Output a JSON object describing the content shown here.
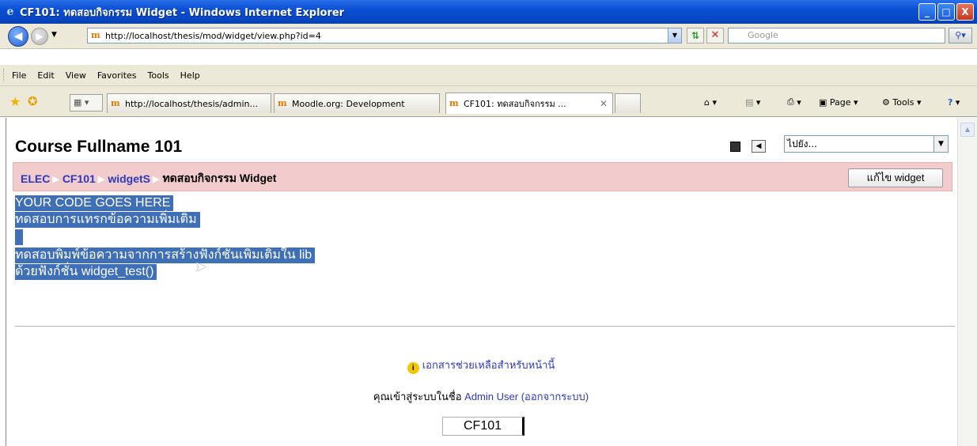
{
  "window": {
    "title": "CF101: ทดสอบกิจกรรม Widget - Windows Internet Explorer",
    "minimize_glyph": "_",
    "maximize_glyph": "□",
    "close_glyph": "X"
  },
  "address": {
    "url": "http://localhost/thesis/mod/widget/view.php?id=4",
    "search_placeholder": "Google"
  },
  "menu": [
    "File",
    "Edit",
    "View",
    "Favorites",
    "Tools",
    "Help"
  ],
  "tabs": [
    {
      "label": "http://localhost/thesis/admin...",
      "active": false
    },
    {
      "label": "Moodle.org: Development",
      "active": false
    },
    {
      "label": "CF101: ทดสอบกิจกรรม ...",
      "active": true
    },
    {
      "label": "",
      "active": false
    }
  ],
  "command_bar": {
    "page": "Page",
    "tools": "Tools"
  },
  "page": {
    "course_title": "Course Fullname 101",
    "jump_select": "ไปยัง...",
    "breadcrumb": [
      "ELEC",
      "CF101",
      "widgetS",
      "ทดสอบกิจกรรม Widget"
    ],
    "edit_button": "แก้ไข widget",
    "content_lines": [
      "YOUR CODE GOES HERE",
      "ทดสอบการแทรกข้อความเพิ่มเติม",
      "",
      "ทดสอบพิมพ์ข้อความจากการสร้างฟังก์ชั่นเพิ่มเติมใน lib",
      "ด้วยฟังก์ชั่น widget_test()"
    ],
    "help_link": "เอกสารช่วยเหลือสำหรับหน้านี้",
    "login_prefix": "คุณเข้าสู่ระบบในชื่อ",
    "login_user": "Admin User",
    "logout_link": "(ออกจากระบบ)",
    "footer_course": "CF101"
  }
}
